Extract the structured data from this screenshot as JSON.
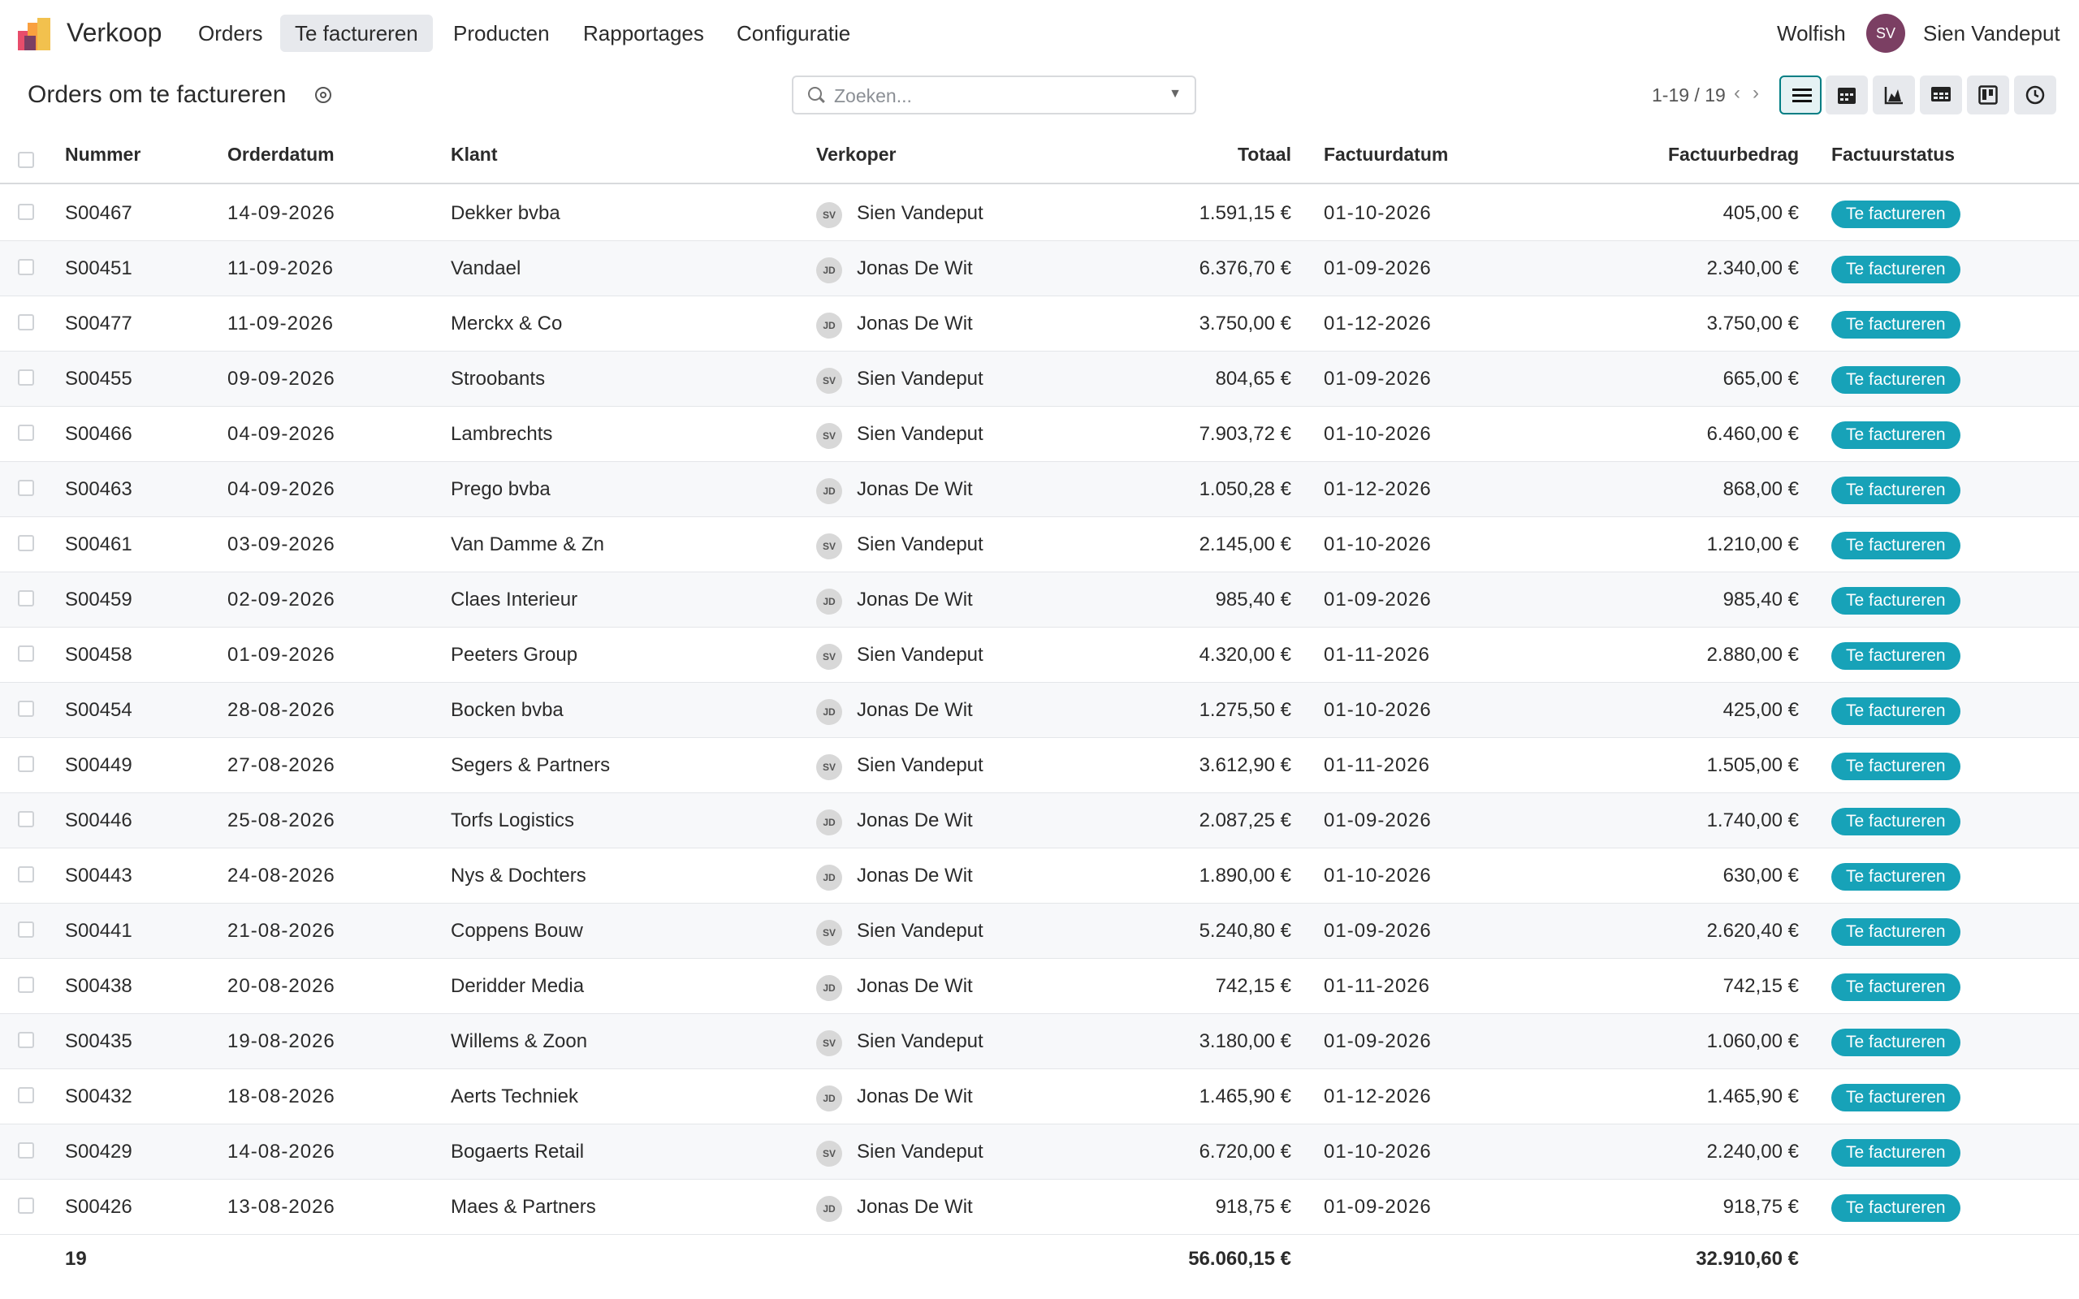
{
  "app": {
    "name": "Verkoop",
    "company": "Wolfish",
    "user_initials": "SV",
    "user_name": "Sien Vandeput"
  },
  "nav": [
    {
      "label": "Orders",
      "active": false
    },
    {
      "label": "Te factureren",
      "active": true
    },
    {
      "label": "Producten",
      "active": false
    },
    {
      "label": "Rapportages",
      "active": false
    },
    {
      "label": "Configuratie",
      "active": false
    }
  ],
  "control": {
    "title": "Orders om te factureren",
    "search_placeholder": "Zoeken...",
    "pager": "1-19 / 19",
    "views": [
      "list-view-icon",
      "calendar-view-icon",
      "graph-view-icon",
      "pivot-view-icon",
      "kanban-view-icon",
      "activity-view-icon"
    ]
  },
  "table": {
    "columns": [
      "Nummer",
      "Orderdatum",
      "Klant",
      "Verkoper",
      "Totaal",
      "Factuurdatum",
      "Factuurbedrag",
      "Factuurstatus"
    ],
    "rows": [
      [
        "S00467",
        "14-09-2026",
        "Dekker bvba",
        "SV",
        "Sien Vandeput",
        "1.591,15 €",
        "01-10-2026",
        "405,00 €",
        "Te factureren"
      ],
      [
        "S00451",
        "11-09-2026",
        "Vandael",
        "JD",
        "Jonas De Wit",
        "6.376,70 €",
        "01-09-2026",
        "2.340,00 €",
        "Te factureren"
      ],
      [
        "S00477",
        "11-09-2026",
        "Merckx & Co",
        "JD",
        "Jonas De Wit",
        "3.750,00 €",
        "01-12-2026",
        "3.750,00 €",
        "Te factureren"
      ],
      [
        "S00455",
        "09-09-2026",
        "Stroobants",
        "SV",
        "Sien Vandeput",
        "804,65 €",
        "01-09-2026",
        "665,00 €",
        "Te factureren"
      ],
      [
        "S00466",
        "04-09-2026",
        "Lambrechts",
        "SV",
        "Sien Vandeput",
        "7.903,72 €",
        "01-10-2026",
        "6.460,00 €",
        "Te factureren"
      ],
      [
        "S00463",
        "04-09-2026",
        "Prego bvba",
        "JD",
        "Jonas De Wit",
        "1.050,28 €",
        "01-12-2026",
        "868,00 €",
        "Te factureren"
      ],
      [
        "S00461",
        "03-09-2026",
        "Van Damme & Zn",
        "SV",
        "Sien Vandeput",
        "2.145,00 €",
        "01-10-2026",
        "1.210,00 €",
        "Te factureren"
      ],
      [
        "S00459",
        "02-09-2026",
        "Claes Interieur",
        "JD",
        "Jonas De Wit",
        "985,40 €",
        "01-09-2026",
        "985,40 €",
        "Te factureren"
      ],
      [
        "S00458",
        "01-09-2026",
        "Peeters Group",
        "SV",
        "Sien Vandeput",
        "4.320,00 €",
        "01-11-2026",
        "2.880,00 €",
        "Te factureren"
      ],
      [
        "S00454",
        "28-08-2026",
        "Bocken bvba",
        "JD",
        "Jonas De Wit",
        "1.275,50 €",
        "01-10-2026",
        "425,00 €",
        "Te factureren"
      ],
      [
        "S00449",
        "27-08-2026",
        "Segers & Partners",
        "SV",
        "Sien Vandeput",
        "3.612,90 €",
        "01-11-2026",
        "1.505,00 €",
        "Te factureren"
      ],
      [
        "S00446",
        "25-08-2026",
        "Torfs Logistics",
        "JD",
        "Jonas De Wit",
        "2.087,25 €",
        "01-09-2026",
        "1.740,00 €",
        "Te factureren"
      ],
      [
        "S00443",
        "24-08-2026",
        "Nys & Dochters",
        "JD",
        "Jonas De Wit",
        "1.890,00 €",
        "01-10-2026",
        "630,00 €",
        "Te factureren"
      ],
      [
        "S00441",
        "21-08-2026",
        "Coppens Bouw",
        "SV",
        "Sien Vandeput",
        "5.240,80 €",
        "01-09-2026",
        "2.620,40 €",
        "Te factureren"
      ],
      [
        "S00438",
        "20-08-2026",
        "Deridder Media",
        "JD",
        "Jonas De Wit",
        "742,15 €",
        "01-11-2026",
        "742,15 €",
        "Te factureren"
      ],
      [
        "S00435",
        "19-08-2026",
        "Willems & Zoon",
        "SV",
        "Sien Vandeput",
        "3.180,00 €",
        "01-09-2026",
        "1.060,00 €",
        "Te factureren"
      ],
      [
        "S00432",
        "18-08-2026",
        "Aerts Techniek",
        "JD",
        "Jonas De Wit",
        "1.465,90 €",
        "01-12-2026",
        "1.465,90 €",
        "Te factureren"
      ],
      [
        "S00429",
        "14-08-2026",
        "Bogaerts Retail",
        "SV",
        "Sien Vandeput",
        "6.720,00 €",
        "01-10-2026",
        "2.240,00 €",
        "Te factureren"
      ],
      [
        "S00426",
        "13-08-2026",
        "Maes & Partners",
        "JD",
        "Jonas De Wit",
        "918,75 €",
        "01-09-2026",
        "918,75 €",
        "Te factureren"
      ]
    ],
    "footer": {
      "count": "19",
      "total": "56.060,15 €",
      "invoice_total": "32.910,60 €"
    }
  },
  "colors": {
    "accent": "#017e84",
    "badge": "#17a2b8",
    "avatar": "#7b3f63"
  }
}
